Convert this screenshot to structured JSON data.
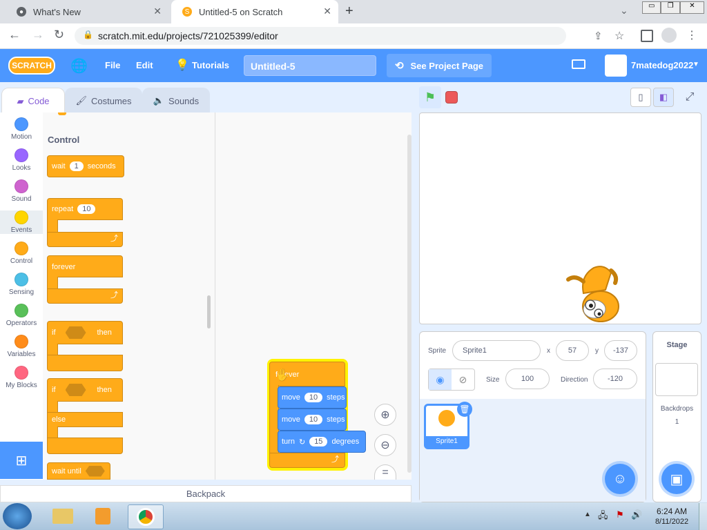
{
  "browser": {
    "tabs": [
      {
        "title": "What's New",
        "close": "✕"
      },
      {
        "title": "Untitled-5 on Scratch",
        "close": "✕"
      }
    ],
    "new_tab": "+",
    "url": "scratch.mit.edu/projects/721025399/editor",
    "window_controls": [
      "⌄",
      "▭",
      "❐",
      "✕"
    ]
  },
  "menu": {
    "logo": "SCRATCH",
    "file": "File",
    "edit": "Edit",
    "tutorials": "Tutorials",
    "project_title": "Untitled-5",
    "see_project": "See Project Page",
    "username": "7matedog2022"
  },
  "editor_tabs": {
    "code": "Code",
    "costumes": "Costumes",
    "sounds": "Sounds"
  },
  "categories": [
    {
      "label": "Motion",
      "color": "#4c97ff"
    },
    {
      "label": "Looks",
      "color": "#9966ff"
    },
    {
      "label": "Sound",
      "color": "#cf63cf"
    },
    {
      "label": "Events",
      "color": "#ffd500"
    },
    {
      "label": "Control",
      "color": "#ffab19"
    },
    {
      "label": "Sensing",
      "color": "#4cbfe6"
    },
    {
      "label": "Operators",
      "color": "#59c059"
    },
    {
      "label": "Variables",
      "color": "#ff8c1a"
    },
    {
      "label": "My Blocks",
      "color": "#ff6680"
    }
  ],
  "palette": {
    "heading": "Control",
    "wait": {
      "label": "wait",
      "value": "1",
      "suffix": "seconds"
    },
    "repeat": {
      "label": "repeat",
      "value": "10"
    },
    "forever": "forever",
    "if_then": {
      "if": "if",
      "then": "then"
    },
    "if_else": {
      "if": "if",
      "then": "then",
      "else": "else"
    },
    "wait_until": "wait until"
  },
  "script": {
    "hat": "forever",
    "move1": {
      "label": "move",
      "value": "10",
      "suffix": "steps"
    },
    "move2": {
      "label": "move",
      "value": "10",
      "suffix": "steps"
    },
    "turn": {
      "label": "turn",
      "value": "15",
      "suffix": "degrees"
    }
  },
  "backpack": "Backpack",
  "sprite_info": {
    "sprite_label": "Sprite",
    "sprite_name": "Sprite1",
    "x_label": "x",
    "x": "57",
    "y_label": "y",
    "y": "-137",
    "size_label": "Size",
    "size": "100",
    "direction_label": "Direction",
    "direction": "-120"
  },
  "sprite_tile": "Sprite1",
  "stage_panel": {
    "title": "Stage",
    "backdrops_label": "Backdrops",
    "backdrops_count": "1"
  },
  "taskbar": {
    "time": "6:24 AM",
    "date": "8/11/2022"
  }
}
